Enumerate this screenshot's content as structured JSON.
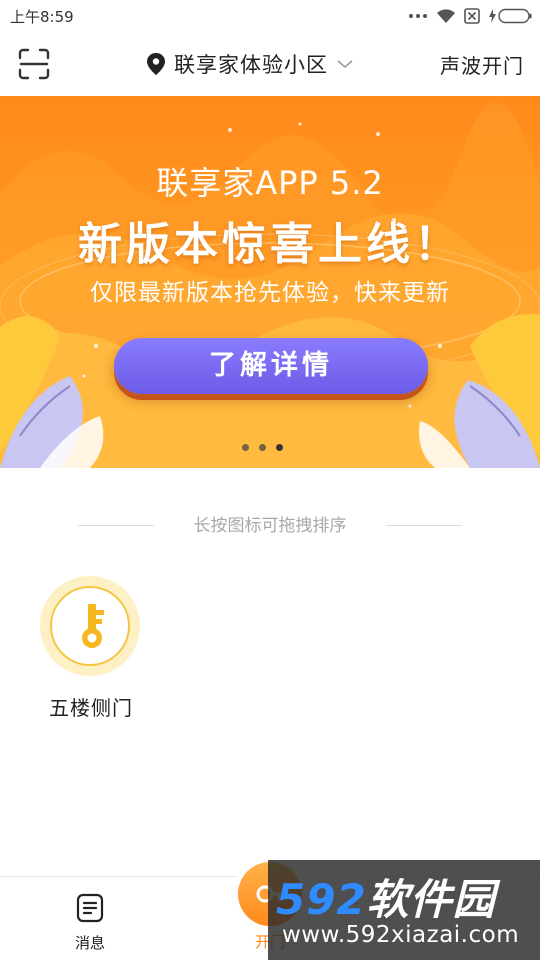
{
  "status_bar": {
    "time": "上午8:59"
  },
  "nav": {
    "scan_icon": "scan-icon",
    "location_icon": "location-pin-icon",
    "community_name": "联享家体验小区",
    "dropdown_icon": "chevron-down-icon",
    "sonic_open_label": "声波开门"
  },
  "banner": {
    "title": "联享家APP 5.2",
    "headline": "新版本惊喜上线！",
    "subtitle": "仅限最新版本抢先体验，快来更新",
    "button_label": "了解详情",
    "dots_total": 3,
    "dots_active_index": 2
  },
  "drag_hint": "长按图标可拖拽排序",
  "doors": [
    {
      "label": "五楼侧门",
      "icon": "key-icon"
    }
  ],
  "tab_bar": {
    "messages_label": "消息",
    "messages_icon": "message-list-icon",
    "open_door_label": "开门",
    "open_door_icon": "door-key-icon"
  },
  "watermark": {
    "brand_num": "592",
    "brand_text": "软件园",
    "url": "www.592xiazai.com"
  },
  "colors": {
    "accent_orange": "#ff8a1c",
    "banner_button": "#6c5ce7",
    "key_yellow": "#f5c542"
  }
}
